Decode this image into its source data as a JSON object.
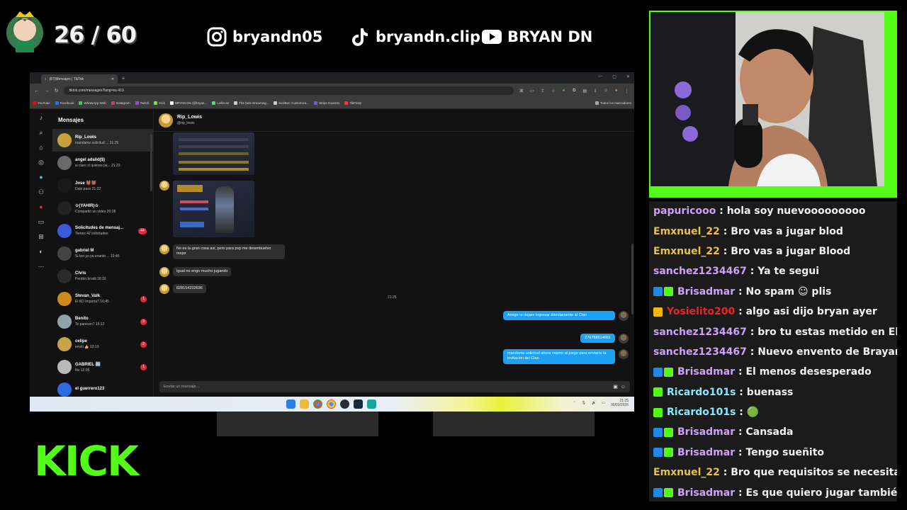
{
  "overlay": {
    "counter": "26 / 60",
    "instagram": "bryandn05",
    "tiktok": "bryandn.clip",
    "youtube": "BRYAN DN",
    "kick_logo": "KICK"
  },
  "browser": {
    "tab_title": "(87)Mensajes | TikTok",
    "url": "tiktok.com/messages?lang=es-419",
    "bookmarks": [
      {
        "label": "YouTube",
        "color": "#ff0000"
      },
      {
        "label": "Facebook",
        "color": "#1877f2"
      },
      {
        "label": "WhatsApp Web",
        "color": "#25d366"
      },
      {
        "label": "Instagram",
        "color": "#e1306c"
      },
      {
        "label": "Twitch",
        "color": "#9146ff"
      },
      {
        "label": "Kick",
        "color": "#53fc18"
      },
      {
        "label": "BRYAN DN (@bryan...",
        "color": "#ffffff"
      },
      {
        "label": "Linktr.ee",
        "color": "#43e55e"
      },
      {
        "label": "The best streaming...",
        "color": "#cccccc"
      },
      {
        "label": "KickBot: Customiza...",
        "color": "#cccccc"
      },
      {
        "label": "Stripe Express",
        "color": "#635bff"
      },
      {
        "label": "TikFinity",
        "color": "#fe2c55"
      }
    ],
    "all_bookmarks": "Todos los marcadores"
  },
  "messages": {
    "title": "Mensajes",
    "conversations": [
      {
        "name": "Rip_Lowis",
        "preview": "mandame solicitud ...  21:25",
        "badge": "",
        "color": "#c9a13c"
      },
      {
        "name": "angel adalid($)",
        "preview": "si claro si quieres pa...  21:23",
        "badge": "",
        "color": "#6a6a6a"
      },
      {
        "name": "Jose 👹👹",
        "preview": "Dale pass  21:22",
        "badge": "",
        "color": "#1a1a1a"
      },
      {
        "name": "☆(YAHIR)☆",
        "preview": "Compartió un video  20:28",
        "badge": "",
        "color": "#222222"
      },
      {
        "name": "Solicitudes de mensaj...",
        "preview": "Tienes 42 solicitudes",
        "badge": "44",
        "color": "#3b5bdb"
      },
      {
        "name": "gabriel M",
        "preview": "Si bro yo ya enanto ...  19:45",
        "badge": "",
        "color": "#444444"
      },
      {
        "name": "Chris",
        "preview": "Perdón brodii  18:16",
        "badge": "",
        "color": "#2a2a2a"
      },
      {
        "name": "Stevan_Valk",
        "preview": "El KD Importa?  16:45",
        "badge": "1",
        "color": "#d08a1c"
      },
      {
        "name": "Benito",
        "preview": "Te parecen?  15:12",
        "badge": "3",
        "color": "#8fa4a8"
      },
      {
        "name": "celipe",
        "preview": "envió 👍  13:19",
        "badge": "2",
        "color": "#c7a34a"
      },
      {
        "name": "GABRIEL 🆒",
        "preview": "No  12:05",
        "badge": "1",
        "color": "#b9b9b9"
      },
      {
        "name": "el guerrero123",
        "preview": "",
        "badge": "",
        "color": "#2d6cdf"
      }
    ],
    "active_chat": {
      "name": "Rip_Lowis",
      "handle": "@rip_lowis",
      "incoming": [
        "No es la gran cosa asi, pero para pvp me desenbuelvo mejor",
        "Igual no engo mucho jugando",
        "828154232696"
      ],
      "timestamp": "21:25",
      "outgoing": [
        "Amigo te dejare ingresar directamente al Clan",
        "276788514891",
        "mandame solicitud ahora mismo al juego para enviarte la invitacion del Clan"
      ],
      "composer_placeholder": "Enviar un mensaje..."
    }
  },
  "taskbar": {
    "time": "21:25",
    "date": "30/03/2026"
  },
  "chat_overlay": [
    {
      "user": "papuricooo",
      "color": "#cfa0f5",
      "text": "hola soy nuevooooooooo",
      "badges": []
    },
    {
      "user": "Emxnuel_22",
      "color": "#e8c04a",
      "text": "Bro vas a jugar blod",
      "badges": []
    },
    {
      "user": "Emxnuel_22",
      "color": "#e8c04a",
      "text": "Bro vas a jugar Blood",
      "badges": []
    },
    {
      "user": "sanchez1234467",
      "color": "#cfa0f5",
      "text": "Ya te segui",
      "badges": []
    },
    {
      "user": "Brisadmar",
      "color": "#cfa0f5",
      "text": "No spam ☺ plis",
      "badges": [
        "#1e88e5",
        "#53fc18"
      ]
    },
    {
      "user": "Yosielito200",
      "color": "#e8252a",
      "text": "algo asi dijo bryan ayer",
      "badges": [
        "#f5b700"
      ]
    },
    {
      "user": "sanchez1234467",
      "color": "#cfa0f5",
      "text": "bro tu estas metido en El Gru",
      "badges": []
    },
    {
      "user": "sanchez1234467",
      "color": "#cfa0f5",
      "text": "Nuevo envento de Brayan se",
      "badges": []
    },
    {
      "user": "Brisadmar",
      "color": "#cfa0f5",
      "text": "El menos desesperado",
      "badges": [
        "#1e88e5",
        "#53fc18"
      ]
    },
    {
      "user": "Ricardo101s",
      "color": "#86e8ff",
      "text": "buenass",
      "badges": [
        "#53fc18"
      ]
    },
    {
      "user": "Ricardo101s",
      "color": "#86e8ff",
      "text": "🟢",
      "badges": [
        "#53fc18"
      ]
    },
    {
      "user": "Brisadmar",
      "color": "#cfa0f5",
      "text": "Cansada",
      "badges": [
        "#1e88e5",
        "#53fc18"
      ]
    },
    {
      "user": "Brisadmar",
      "color": "#cfa0f5",
      "text": "Tengo sueñito",
      "badges": [
        "#1e88e5",
        "#53fc18"
      ]
    },
    {
      "user": "Emxnuel_22",
      "color": "#e8c04a",
      "text": "Bro que requisitos se necesita ? pa",
      "badges": []
    },
    {
      "user": "Brisadmar",
      "color": "#cfa0f5",
      "text": "Es que quiero jugar también pe",
      "badges": [
        "#1e88e5",
        "#53fc18"
      ]
    }
  ]
}
